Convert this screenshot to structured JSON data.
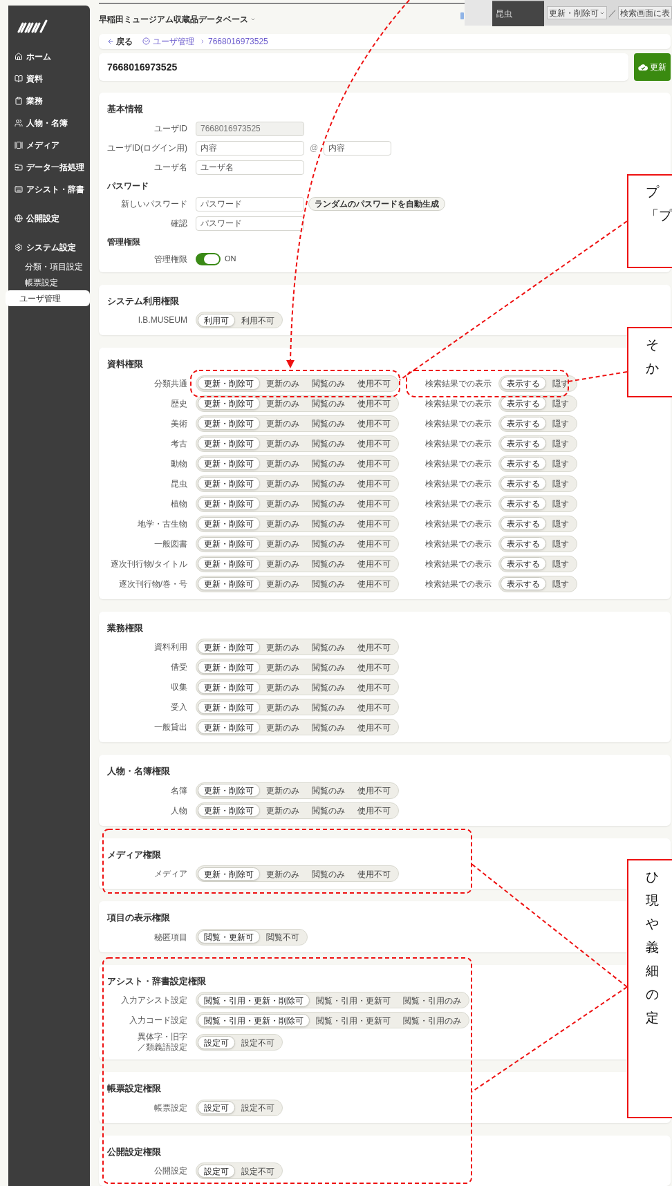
{
  "app": {
    "title": "早稲田ミュージアム収蔵品データベース"
  },
  "inset": {
    "row_label": "昆虫",
    "select": "更新・削除可",
    "separator": "／",
    "field": "検索画面に表"
  },
  "sidebar": {
    "items": [
      {
        "label": "ホーム",
        "selected": false
      },
      {
        "label": "資料",
        "selected": false
      },
      {
        "label": "業務",
        "selected": false
      },
      {
        "label": "人物・名簿",
        "selected": false
      },
      {
        "label": "メディア",
        "selected": false
      },
      {
        "label": "データ一括処理",
        "selected": false
      },
      {
        "label": "アシスト・辞書",
        "selected": false
      },
      {
        "label": "公開設定",
        "selected": false
      },
      {
        "label": "システム設定",
        "selected": false,
        "children": [
          {
            "label": "分類・項目設定",
            "selected": false
          },
          {
            "label": "帳票設定",
            "selected": false
          },
          {
            "label": "ユーザ管理",
            "selected": true
          }
        ]
      }
    ]
  },
  "breadcrumb": {
    "back": "戻る",
    "items": [
      "ユーザ管理",
      "7668016973525"
    ]
  },
  "page_title": "7668016973525",
  "update_button": "更新",
  "basic_info": {
    "title": "基本情報",
    "rows": [
      {
        "kind": "field",
        "label": "ユーザID",
        "value": "7668016973525",
        "disabled": true
      },
      {
        "kind": "email",
        "label": "ユーザID(ログイン用)",
        "value": "内容",
        "at": "@",
        "domain": "内容"
      },
      {
        "kind": "field",
        "label": "ユーザ名",
        "value": "ユーザ名",
        "disabled": false
      },
      {
        "kind": "heading",
        "label": "パスワード"
      },
      {
        "kind": "password",
        "label": "新しいパスワード",
        "value": "パスワード",
        "button": "ランダムのパスワードを自動生成"
      },
      {
        "kind": "field",
        "label": "確認",
        "value": "パスワード",
        "disabled": false
      },
      {
        "kind": "heading",
        "label": "管理権限"
      },
      {
        "kind": "toggle",
        "label": "管理権限",
        "on": true,
        "state_text": "ON"
      }
    ]
  },
  "sections": [
    {
      "title": "システム利用権限",
      "rows": [
        {
          "label": "I.B.MUSEUM",
          "options": [
            {
              "label": "利用可",
              "selected": true
            },
            {
              "label": "利用不可",
              "selected": false
            }
          ]
        }
      ]
    },
    {
      "title": "資料権限",
      "rows": [
        {
          "label": "分類共通",
          "options": [
            {
              "label": "更新・削除可",
              "selected": true
            },
            {
              "label": "更新のみ",
              "selected": false
            },
            {
              "label": "閲覧のみ",
              "selected": false
            },
            {
              "label": "使用不可",
              "selected": false
            }
          ],
          "search": {
            "label": "検索結果での表示",
            "options": [
              {
                "label": "表示する",
                "selected": true
              },
              {
                "label": "隠す",
                "selected": false
              }
            ]
          }
        },
        {
          "label": "歴史",
          "options": [
            {
              "label": "更新・削除可",
              "selected": true
            },
            {
              "label": "更新のみ",
              "selected": false
            },
            {
              "label": "閲覧のみ",
              "selected": false
            },
            {
              "label": "使用不可",
              "selected": false
            }
          ],
          "search": {
            "label": "検索結果での表示",
            "options": [
              {
                "label": "表示する",
                "selected": true
              },
              {
                "label": "隠す",
                "selected": false
              }
            ]
          }
        },
        {
          "label": "美術",
          "options": [
            {
              "label": "更新・削除可",
              "selected": true
            },
            {
              "label": "更新のみ",
              "selected": false
            },
            {
              "label": "閲覧のみ",
              "selected": false
            },
            {
              "label": "使用不可",
              "selected": false
            }
          ],
          "search": {
            "label": "検索結果での表示",
            "options": [
              {
                "label": "表示する",
                "selected": true
              },
              {
                "label": "隠す",
                "selected": false
              }
            ]
          }
        },
        {
          "label": "考古",
          "options": [
            {
              "label": "更新・削除可",
              "selected": true
            },
            {
              "label": "更新のみ",
              "selected": false
            },
            {
              "label": "閲覧のみ",
              "selected": false
            },
            {
              "label": "使用不可",
              "selected": false
            }
          ],
          "search": {
            "label": "検索結果での表示",
            "options": [
              {
                "label": "表示する",
                "selected": true
              },
              {
                "label": "隠す",
                "selected": false
              }
            ]
          }
        },
        {
          "label": "動物",
          "options": [
            {
              "label": "更新・削除可",
              "selected": true
            },
            {
              "label": "更新のみ",
              "selected": false
            },
            {
              "label": "閲覧のみ",
              "selected": false
            },
            {
              "label": "使用不可",
              "selected": false
            }
          ],
          "search": {
            "label": "検索結果での表示",
            "options": [
              {
                "label": "表示する",
                "selected": true
              },
              {
                "label": "隠す",
                "selected": false
              }
            ]
          }
        },
        {
          "label": "昆虫",
          "options": [
            {
              "label": "更新・削除可",
              "selected": true
            },
            {
              "label": "更新のみ",
              "selected": false
            },
            {
              "label": "閲覧のみ",
              "selected": false
            },
            {
              "label": "使用不可",
              "selected": false
            }
          ],
          "search": {
            "label": "検索結果での表示",
            "options": [
              {
                "label": "表示する",
                "selected": true
              },
              {
                "label": "隠す",
                "selected": false
              }
            ]
          }
        },
        {
          "label": "植物",
          "options": [
            {
              "label": "更新・削除可",
              "selected": true
            },
            {
              "label": "更新のみ",
              "selected": false
            },
            {
              "label": "閲覧のみ",
              "selected": false
            },
            {
              "label": "使用不可",
              "selected": false
            }
          ],
          "search": {
            "label": "検索結果での表示",
            "options": [
              {
                "label": "表示する",
                "selected": true
              },
              {
                "label": "隠す",
                "selected": false
              }
            ]
          }
        },
        {
          "label": "地学・古生物",
          "options": [
            {
              "label": "更新・削除可",
              "selected": true
            },
            {
              "label": "更新のみ",
              "selected": false
            },
            {
              "label": "閲覧のみ",
              "selected": false
            },
            {
              "label": "使用不可",
              "selected": false
            }
          ],
          "search": {
            "label": "検索結果での表示",
            "options": [
              {
                "label": "表示する",
                "selected": true
              },
              {
                "label": "隠す",
                "selected": false
              }
            ]
          }
        },
        {
          "label": "一般図書",
          "options": [
            {
              "label": "更新・削除可",
              "selected": true
            },
            {
              "label": "更新のみ",
              "selected": false
            },
            {
              "label": "閲覧のみ",
              "selected": false
            },
            {
              "label": "使用不可",
              "selected": false
            }
          ],
          "search": {
            "label": "検索結果での表示",
            "options": [
              {
                "label": "表示する",
                "selected": true
              },
              {
                "label": "隠す",
                "selected": false
              }
            ]
          }
        },
        {
          "label": "逐次刊行物/タイトル",
          "options": [
            {
              "label": "更新・削除可",
              "selected": true
            },
            {
              "label": "更新のみ",
              "selected": false
            },
            {
              "label": "閲覧のみ",
              "selected": false
            },
            {
              "label": "使用不可",
              "selected": false
            }
          ],
          "search": {
            "label": "検索結果での表示",
            "options": [
              {
                "label": "表示する",
                "selected": true
              },
              {
                "label": "隠す",
                "selected": false
              }
            ]
          }
        },
        {
          "label": "逐次刊行物/巻・号",
          "options": [
            {
              "label": "更新・削除可",
              "selected": true
            },
            {
              "label": "更新のみ",
              "selected": false
            },
            {
              "label": "閲覧のみ",
              "selected": false
            },
            {
              "label": "使用不可",
              "selected": false
            }
          ],
          "search": {
            "label": "検索結果での表示",
            "options": [
              {
                "label": "表示する",
                "selected": true
              },
              {
                "label": "隠す",
                "selected": false
              }
            ]
          }
        }
      ]
    },
    {
      "title": "業務権限",
      "rows": [
        {
          "label": "資料利用",
          "options": [
            {
              "label": "更新・削除可",
              "selected": true
            },
            {
              "label": "更新のみ",
              "selected": false
            },
            {
              "label": "閲覧のみ",
              "selected": false
            },
            {
              "label": "使用不可",
              "selected": false
            }
          ]
        },
        {
          "label": "借受",
          "options": [
            {
              "label": "更新・削除可",
              "selected": true
            },
            {
              "label": "更新のみ",
              "selected": false
            },
            {
              "label": "閲覧のみ",
              "selected": false
            },
            {
              "label": "使用不可",
              "selected": false
            }
          ]
        },
        {
          "label": "収集",
          "options": [
            {
              "label": "更新・削除可",
              "selected": true
            },
            {
              "label": "更新のみ",
              "selected": false
            },
            {
              "label": "閲覧のみ",
              "selected": false
            },
            {
              "label": "使用不可",
              "selected": false
            }
          ]
        },
        {
          "label": "受入",
          "options": [
            {
              "label": "更新・削除可",
              "selected": true
            },
            {
              "label": "更新のみ",
              "selected": false
            },
            {
              "label": "閲覧のみ",
              "selected": false
            },
            {
              "label": "使用不可",
              "selected": false
            }
          ]
        },
        {
          "label": "一般貸出",
          "options": [
            {
              "label": "更新・削除可",
              "selected": true
            },
            {
              "label": "更新のみ",
              "selected": false
            },
            {
              "label": "閲覧のみ",
              "selected": false
            },
            {
              "label": "使用不可",
              "selected": false
            }
          ]
        }
      ]
    },
    {
      "title": "人物・名簿権限",
      "rows": [
        {
          "label": "名簿",
          "options": [
            {
              "label": "更新・削除可",
              "selected": true
            },
            {
              "label": "更新のみ",
              "selected": false
            },
            {
              "label": "閲覧のみ",
              "selected": false
            },
            {
              "label": "使用不可",
              "selected": false
            }
          ]
        },
        {
          "label": "人物",
          "options": [
            {
              "label": "更新・削除可",
              "selected": true
            },
            {
              "label": "更新のみ",
              "selected": false
            },
            {
              "label": "閲覧のみ",
              "selected": false
            },
            {
              "label": "使用不可",
              "selected": false
            }
          ]
        }
      ]
    },
    {
      "title": "メディア権限",
      "rows": [
        {
          "label": "メディア",
          "options": [
            {
              "label": "更新・削除可",
              "selected": true
            },
            {
              "label": "更新のみ",
              "selected": false
            },
            {
              "label": "閲覧のみ",
              "selected": false
            },
            {
              "label": "使用不可",
              "selected": false
            }
          ]
        }
      ]
    },
    {
      "title": "項目の表示権限",
      "rows": [
        {
          "label": "秘匿項目",
          "options": [
            {
              "label": "閲覧・更新可",
              "selected": true
            },
            {
              "label": "閲覧不可",
              "selected": false
            }
          ]
        }
      ]
    },
    {
      "title": "アシスト・辞書設定権限",
      "rows": [
        {
          "label": "入力アシスト設定",
          "options": [
            {
              "label": "閲覧・引用・更新・削除可",
              "selected": true
            },
            {
              "label": "閲覧・引用・更新可",
              "selected": false
            },
            {
              "label": "閲覧・引用のみ",
              "selected": false
            }
          ]
        },
        {
          "label": "入力コード設定",
          "options": [
            {
              "label": "閲覧・引用・更新・削除可",
              "selected": true
            },
            {
              "label": "閲覧・引用・更新可",
              "selected": false
            },
            {
              "label": "閲覧・引用のみ",
              "selected": false
            }
          ]
        },
        {
          "label_lines": [
            "異体字・旧字",
            "／類義語設定"
          ],
          "options": [
            {
              "label": "設定可",
              "selected": true
            },
            {
              "label": "設定不可",
              "selected": false
            }
          ]
        }
      ]
    },
    {
      "title": "帳票設定権限",
      "rows": [
        {
          "label": "帳票設定",
          "options": [
            {
              "label": "設定可",
              "selected": true
            },
            {
              "label": "設定不可",
              "selected": false
            }
          ]
        }
      ]
    },
    {
      "title": "公開設定権限",
      "rows": [
        {
          "label": "公開設定",
          "options": [
            {
              "label": "設定可",
              "selected": true
            },
            {
              "label": "設定不可",
              "selected": false
            }
          ]
        }
      ]
    }
  ],
  "callouts": [
    {
      "lines": [
        "プ",
        "「プ"
      ]
    },
    {
      "lines": [
        "そ",
        "か"
      ]
    },
    {
      "lines": [
        "ひ",
        "現",
        "や",
        "義",
        "細",
        "の",
        "定"
      ]
    }
  ]
}
